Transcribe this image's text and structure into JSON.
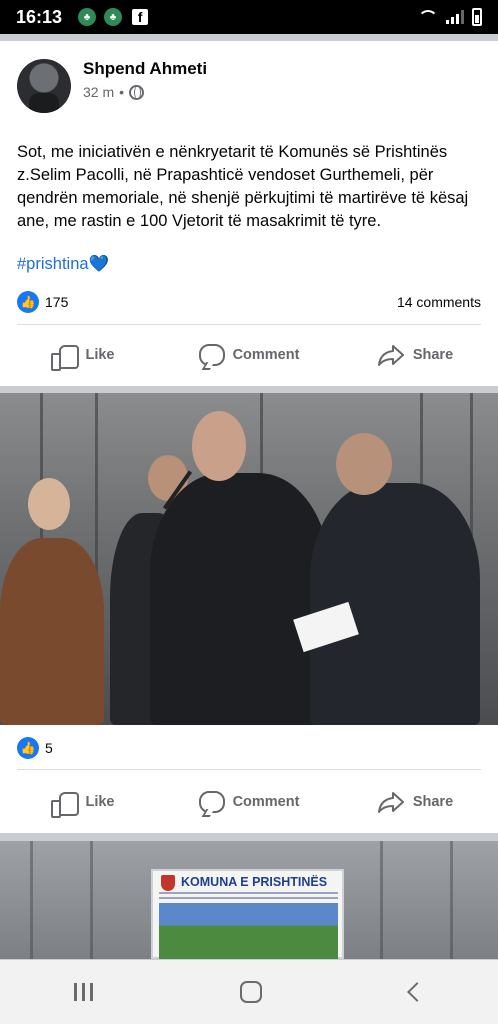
{
  "status_bar": {
    "time": "16:13",
    "icons": [
      "app-notification-icon",
      "app-notification-icon",
      "facebook-icon",
      "wifi-icon",
      "signal-icon",
      "battery-icon"
    ]
  },
  "post": {
    "author": "Shpend Ahmeti",
    "time_ago": "32 m",
    "separator": "•",
    "audience_icon": "globe-icon",
    "text": "Sot, me iniciativën e nënkryetarit të Komunës së Prishtinës z.Selim Pacolli, në Prapashticë vendoset Gurthemeli, për qendrën memoriale, në shenjë përkujtimi të martirëve të kësaj ane, me rastin e 100 Vjetorit të masakrimit të tyre.",
    "hashtag": "#prishtina",
    "hashtag_emoji": "💙",
    "reactions_count": "175",
    "comments_count": "14 comments"
  },
  "actions": {
    "like": "Like",
    "comment": "Comment",
    "share": "Share"
  },
  "photo_post": {
    "reactions_count": "5"
  },
  "sign": {
    "title": "KOMUNA E PRISHTINËS"
  },
  "colors": {
    "facebook_blue": "#1877f2",
    "hashtag_blue": "#216fdb",
    "secondary_text": "#65676b"
  }
}
